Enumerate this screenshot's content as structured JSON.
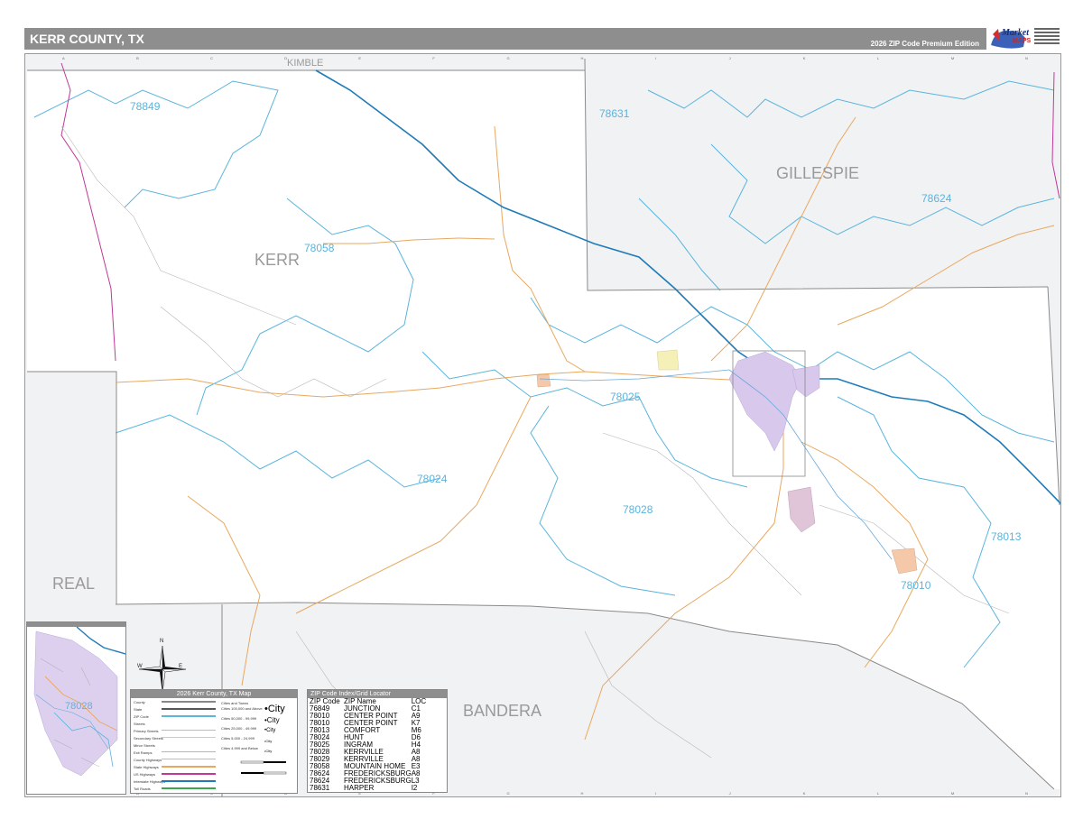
{
  "header": {
    "title": "KERR COUNTY, TX",
    "edition": "2026 ZIP Code Premium Edition"
  },
  "logo": {
    "word": "Market",
    "maps": "MAPS"
  },
  "colors": {
    "zip_boundary": "#5ab4dc",
    "county_boundary": "#8a8a8a",
    "outside_fill": "#f1f2f4",
    "county_fill": "#ffffff",
    "interstate": "#1f7bb8",
    "state_highway": "#e8a860",
    "city_fill": "#d8c8ec",
    "city_fill_alt": "#f4c8a8",
    "title_bar": "#8e8e8e",
    "state_line": "#c0399a"
  },
  "map": {
    "county_labels": [
      {
        "id": "kimble",
        "text": "KIMBLE"
      },
      {
        "id": "gillespie",
        "text": "GILLESPIE"
      },
      {
        "id": "kerr",
        "text": "KERR"
      },
      {
        "id": "real",
        "text": "REAL"
      },
      {
        "id": "bandera",
        "text": "BANDERA"
      }
    ],
    "zip_labels": [
      {
        "id": "z78849",
        "text": "78849"
      },
      {
        "id": "z78631",
        "text": "78631"
      },
      {
        "id": "z78624",
        "text": "78624"
      },
      {
        "id": "z78058",
        "text": "78058"
      },
      {
        "id": "z78025",
        "text": "78025"
      },
      {
        "id": "z78024",
        "text": "78024"
      },
      {
        "id": "z78028",
        "text": "78028"
      },
      {
        "id": "z78013",
        "text": "78013"
      },
      {
        "id": "z78010",
        "text": "78010"
      },
      {
        "id": "z78028_inset",
        "text": "78028"
      }
    ],
    "grid_columns": [
      "A",
      "B",
      "C",
      "D",
      "E",
      "F",
      "G",
      "H",
      "I",
      "J",
      "K",
      "L",
      "M",
      "N"
    ]
  },
  "compass": {
    "n": "N",
    "s": "S",
    "e": "E",
    "w": "W"
  },
  "legend": {
    "title": "2026 Kerr County, TX Map",
    "rows": [
      "County",
      "State",
      "ZIP Code",
      "Streets",
      "Primary Streets",
      "Secondary Streets",
      "Minor Streets",
      "Exit Ramps",
      "County Highways",
      "State Highways",
      "US Highways",
      "Interstate Highways",
      "Toll Roads"
    ],
    "cities_header": "Cities and Towns",
    "city_tiers": [
      {
        "range": "Cities 100,000 and Above",
        "sample": "•City"
      },
      {
        "range": "Cities 50,000 - 99,999",
        "sample": "•City"
      },
      {
        "range": "Cities 25,000 - 49,999",
        "sample": "•City"
      },
      {
        "range": "Cities 5,000 - 24,999",
        "sample": "•City"
      },
      {
        "range": "Cities 4,999 and Below",
        "sample": "•City"
      }
    ]
  },
  "zip_index": {
    "title": "ZIP Code Index/Grid Locator",
    "headers": [
      "ZIP Code",
      "ZIP Name",
      "LOC"
    ],
    "rows": [
      [
        "76849",
        "JUNCTION",
        "C1"
      ],
      [
        "78010",
        "CENTER POINT",
        "A9"
      ],
      [
        "78010",
        "CENTER POINT",
        "K7"
      ],
      [
        "78013",
        "COMFORT",
        "M6"
      ],
      [
        "78024",
        "HUNT",
        "D6"
      ],
      [
        "78025",
        "INGRAM",
        "H4"
      ],
      [
        "78028",
        "KERRVILLE",
        "A8"
      ],
      [
        "78029",
        "KERRVILLE",
        "A8"
      ],
      [
        "78058",
        "MOUNTAIN HOME",
        "E3"
      ],
      [
        "78624",
        "FREDERICKSBURG",
        "A8"
      ],
      [
        "78624",
        "FREDERICKSBURG",
        "L3"
      ],
      [
        "78631",
        "HARPER",
        "I2"
      ]
    ]
  }
}
